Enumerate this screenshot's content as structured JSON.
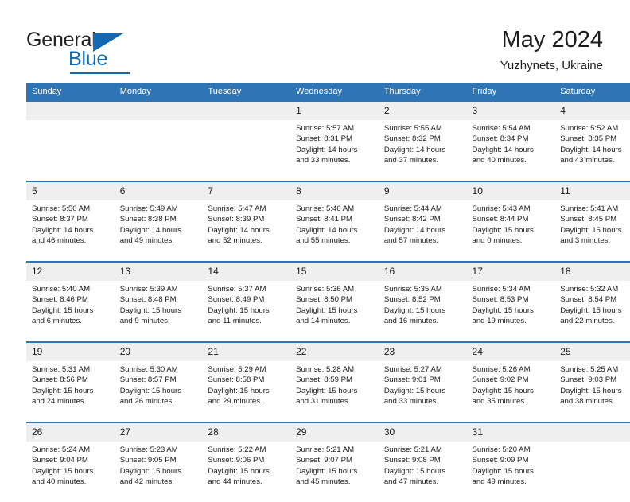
{
  "brand": {
    "name_part1": "General",
    "name_part2": "Blue",
    "triangle_icon": "triangle-icon",
    "accent_color": "#1268b3"
  },
  "header": {
    "title": "May 2024",
    "subtitle": "Yuzhynets, Ukraine"
  },
  "theme": {
    "header_blue": "#2e75b6",
    "daynum_band": "#efefef",
    "text": "#1a1a1a"
  },
  "weekday_headers": [
    "Sunday",
    "Monday",
    "Tuesday",
    "Wednesday",
    "Thursday",
    "Friday",
    "Saturday"
  ],
  "labels": {
    "sunrise_prefix": "Sunrise:",
    "sunset_prefix": "Sunset:",
    "daylight_prefix": "Daylight:"
  },
  "weeks": [
    [
      {
        "day": "",
        "empty": true,
        "line1": "",
        "line2": "",
        "line3": "",
        "line4": ""
      },
      {
        "day": "",
        "empty": true,
        "line1": "",
        "line2": "",
        "line3": "",
        "line4": ""
      },
      {
        "day": "",
        "empty": true,
        "line1": "",
        "line2": "",
        "line3": "",
        "line4": ""
      },
      {
        "day": "1",
        "empty": false,
        "line1": "Sunrise: 5:57 AM",
        "line2": "Sunset: 8:31 PM",
        "line3": "Daylight: 14 hours",
        "line4": "and 33 minutes."
      },
      {
        "day": "2",
        "empty": false,
        "line1": "Sunrise: 5:55 AM",
        "line2": "Sunset: 8:32 PM",
        "line3": "Daylight: 14 hours",
        "line4": "and 37 minutes."
      },
      {
        "day": "3",
        "empty": false,
        "line1": "Sunrise: 5:54 AM",
        "line2": "Sunset: 8:34 PM",
        "line3": "Daylight: 14 hours",
        "line4": "and 40 minutes."
      },
      {
        "day": "4",
        "empty": false,
        "line1": "Sunrise: 5:52 AM",
        "line2": "Sunset: 8:35 PM",
        "line3": "Daylight: 14 hours",
        "line4": "and 43 minutes."
      }
    ],
    [
      {
        "day": "5",
        "empty": false,
        "line1": "Sunrise: 5:50 AM",
        "line2": "Sunset: 8:37 PM",
        "line3": "Daylight: 14 hours",
        "line4": "and 46 minutes."
      },
      {
        "day": "6",
        "empty": false,
        "line1": "Sunrise: 5:49 AM",
        "line2": "Sunset: 8:38 PM",
        "line3": "Daylight: 14 hours",
        "line4": "and 49 minutes."
      },
      {
        "day": "7",
        "empty": false,
        "line1": "Sunrise: 5:47 AM",
        "line2": "Sunset: 8:39 PM",
        "line3": "Daylight: 14 hours",
        "line4": "and 52 minutes."
      },
      {
        "day": "8",
        "empty": false,
        "line1": "Sunrise: 5:46 AM",
        "line2": "Sunset: 8:41 PM",
        "line3": "Daylight: 14 hours",
        "line4": "and 55 minutes."
      },
      {
        "day": "9",
        "empty": false,
        "line1": "Sunrise: 5:44 AM",
        "line2": "Sunset: 8:42 PM",
        "line3": "Daylight: 14 hours",
        "line4": "and 57 minutes."
      },
      {
        "day": "10",
        "empty": false,
        "line1": "Sunrise: 5:43 AM",
        "line2": "Sunset: 8:44 PM",
        "line3": "Daylight: 15 hours",
        "line4": "and 0 minutes."
      },
      {
        "day": "11",
        "empty": false,
        "line1": "Sunrise: 5:41 AM",
        "line2": "Sunset: 8:45 PM",
        "line3": "Daylight: 15 hours",
        "line4": "and 3 minutes."
      }
    ],
    [
      {
        "day": "12",
        "empty": false,
        "line1": "Sunrise: 5:40 AM",
        "line2": "Sunset: 8:46 PM",
        "line3": "Daylight: 15 hours",
        "line4": "and 6 minutes."
      },
      {
        "day": "13",
        "empty": false,
        "line1": "Sunrise: 5:39 AM",
        "line2": "Sunset: 8:48 PM",
        "line3": "Daylight: 15 hours",
        "line4": "and 9 minutes."
      },
      {
        "day": "14",
        "empty": false,
        "line1": "Sunrise: 5:37 AM",
        "line2": "Sunset: 8:49 PM",
        "line3": "Daylight: 15 hours",
        "line4": "and 11 minutes."
      },
      {
        "day": "15",
        "empty": false,
        "line1": "Sunrise: 5:36 AM",
        "line2": "Sunset: 8:50 PM",
        "line3": "Daylight: 15 hours",
        "line4": "and 14 minutes."
      },
      {
        "day": "16",
        "empty": false,
        "line1": "Sunrise: 5:35 AM",
        "line2": "Sunset: 8:52 PM",
        "line3": "Daylight: 15 hours",
        "line4": "and 16 minutes."
      },
      {
        "day": "17",
        "empty": false,
        "line1": "Sunrise: 5:34 AM",
        "line2": "Sunset: 8:53 PM",
        "line3": "Daylight: 15 hours",
        "line4": "and 19 minutes."
      },
      {
        "day": "18",
        "empty": false,
        "line1": "Sunrise: 5:32 AM",
        "line2": "Sunset: 8:54 PM",
        "line3": "Daylight: 15 hours",
        "line4": "and 22 minutes."
      }
    ],
    [
      {
        "day": "19",
        "empty": false,
        "line1": "Sunrise: 5:31 AM",
        "line2": "Sunset: 8:56 PM",
        "line3": "Daylight: 15 hours",
        "line4": "and 24 minutes."
      },
      {
        "day": "20",
        "empty": false,
        "line1": "Sunrise: 5:30 AM",
        "line2": "Sunset: 8:57 PM",
        "line3": "Daylight: 15 hours",
        "line4": "and 26 minutes."
      },
      {
        "day": "21",
        "empty": false,
        "line1": "Sunrise: 5:29 AM",
        "line2": "Sunset: 8:58 PM",
        "line3": "Daylight: 15 hours",
        "line4": "and 29 minutes."
      },
      {
        "day": "22",
        "empty": false,
        "line1": "Sunrise: 5:28 AM",
        "line2": "Sunset: 8:59 PM",
        "line3": "Daylight: 15 hours",
        "line4": "and 31 minutes."
      },
      {
        "day": "23",
        "empty": false,
        "line1": "Sunrise: 5:27 AM",
        "line2": "Sunset: 9:01 PM",
        "line3": "Daylight: 15 hours",
        "line4": "and 33 minutes."
      },
      {
        "day": "24",
        "empty": false,
        "line1": "Sunrise: 5:26 AM",
        "line2": "Sunset: 9:02 PM",
        "line3": "Daylight: 15 hours",
        "line4": "and 35 minutes."
      },
      {
        "day": "25",
        "empty": false,
        "line1": "Sunrise: 5:25 AM",
        "line2": "Sunset: 9:03 PM",
        "line3": "Daylight: 15 hours",
        "line4": "and 38 minutes."
      }
    ],
    [
      {
        "day": "26",
        "empty": false,
        "line1": "Sunrise: 5:24 AM",
        "line2": "Sunset: 9:04 PM",
        "line3": "Daylight: 15 hours",
        "line4": "and 40 minutes."
      },
      {
        "day": "27",
        "empty": false,
        "line1": "Sunrise: 5:23 AM",
        "line2": "Sunset: 9:05 PM",
        "line3": "Daylight: 15 hours",
        "line4": "and 42 minutes."
      },
      {
        "day": "28",
        "empty": false,
        "line1": "Sunrise: 5:22 AM",
        "line2": "Sunset: 9:06 PM",
        "line3": "Daylight: 15 hours",
        "line4": "and 44 minutes."
      },
      {
        "day": "29",
        "empty": false,
        "line1": "Sunrise: 5:21 AM",
        "line2": "Sunset: 9:07 PM",
        "line3": "Daylight: 15 hours",
        "line4": "and 45 minutes."
      },
      {
        "day": "30",
        "empty": false,
        "line1": "Sunrise: 5:21 AM",
        "line2": "Sunset: 9:08 PM",
        "line3": "Daylight: 15 hours",
        "line4": "and 47 minutes."
      },
      {
        "day": "31",
        "empty": false,
        "line1": "Sunrise: 5:20 AM",
        "line2": "Sunset: 9:09 PM",
        "line3": "Daylight: 15 hours",
        "line4": "and 49 minutes."
      },
      {
        "day": "",
        "empty": true,
        "line1": "",
        "line2": "",
        "line3": "",
        "line4": ""
      }
    ]
  ]
}
